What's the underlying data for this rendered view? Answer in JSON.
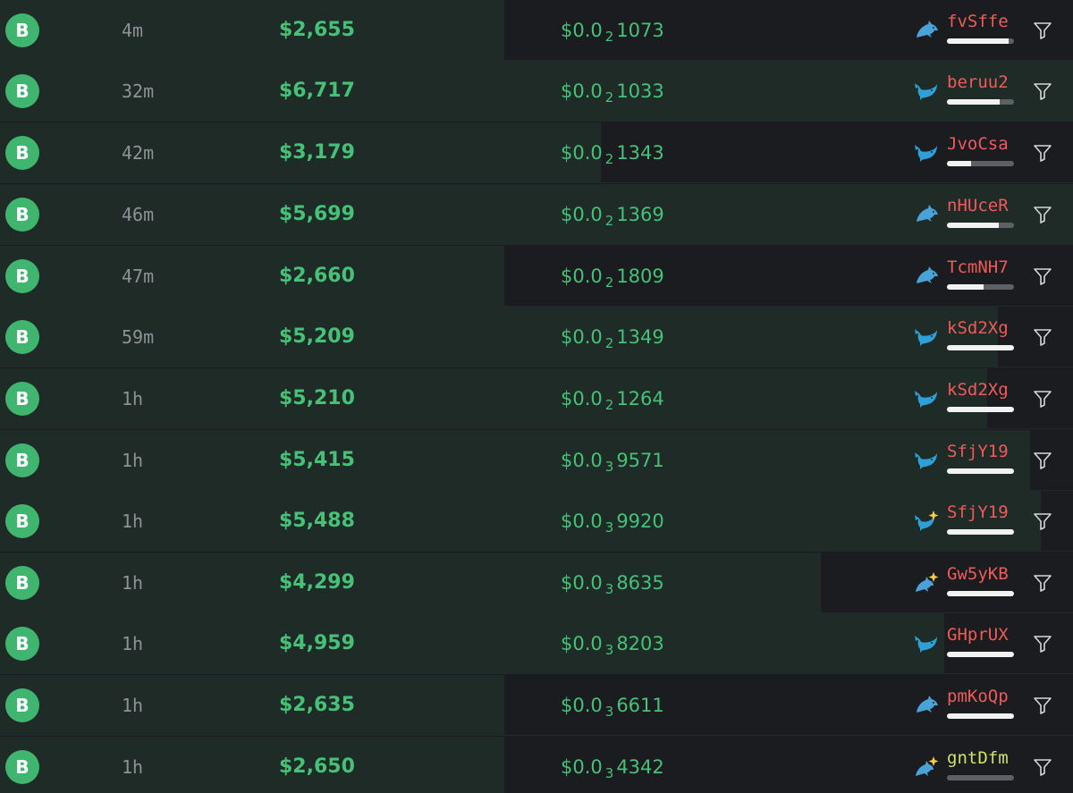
{
  "rows": [
    {
      "side": "B",
      "age": "4m",
      "usd": "$2,655",
      "price_prefix": "$0.0",
      "price_zeros": "2",
      "price_digits": "1073",
      "maker": "fvSffe",
      "maker_icon": "dolphin-icon",
      "maker_color": "red",
      "maker_level": 0.92,
      "bar_fraction": 0.47
    },
    {
      "side": "B",
      "age": "32m",
      "usd": "$6,717",
      "price_prefix": "$0.0",
      "price_zeros": "2",
      "price_digits": "1033",
      "maker": "beruu2",
      "maker_icon": "whale-icon",
      "maker_color": "red",
      "maker_level": 0.78,
      "bar_fraction": 1.0
    },
    {
      "side": "B",
      "age": "42m",
      "usd": "$3,179",
      "price_prefix": "$0.0",
      "price_zeros": "2",
      "price_digits": "1343",
      "maker": "JvoCsa",
      "maker_icon": "whale-icon",
      "maker_color": "red",
      "maker_level": 0.36,
      "bar_fraction": 0.56
    },
    {
      "side": "B",
      "age": "46m",
      "usd": "$5,699",
      "price_prefix": "$0.0",
      "price_zeros": "2",
      "price_digits": "1369",
      "maker": "nHUceR",
      "maker_icon": "dolphin-icon",
      "maker_color": "red",
      "maker_level": 0.77,
      "bar_fraction": 1.0
    },
    {
      "side": "B",
      "age": "47m",
      "usd": "$2,660",
      "price_prefix": "$0.0",
      "price_zeros": "2",
      "price_digits": "1809",
      "maker": "TcmNH7",
      "maker_icon": "dolphin-icon",
      "maker_color": "red",
      "maker_level": 0.54,
      "bar_fraction": 0.47
    },
    {
      "side": "B",
      "age": "59m",
      "usd": "$5,209",
      "price_prefix": "$0.0",
      "price_zeros": "2",
      "price_digits": "1349",
      "maker": "kSd2Xg",
      "maker_icon": "whale-icon",
      "maker_color": "red",
      "maker_level": 1.0,
      "bar_fraction": 0.93
    },
    {
      "side": "B",
      "age": "1h",
      "usd": "$5,210",
      "price_prefix": "$0.0",
      "price_zeros": "2",
      "price_digits": "1264",
      "maker": "kSd2Xg",
      "maker_icon": "whale-icon",
      "maker_color": "red",
      "maker_level": 1.0,
      "bar_fraction": 0.92
    },
    {
      "side": "B",
      "age": "1h",
      "usd": "$5,415",
      "price_prefix": "$0.0",
      "price_zeros": "3",
      "price_digits": "9571",
      "maker": "SfjY19",
      "maker_icon": "whale-icon",
      "maker_color": "red",
      "maker_level": 1.0,
      "bar_fraction": 0.96
    },
    {
      "side": "B",
      "age": "1h",
      "usd": "$5,488",
      "price_prefix": "$0.0",
      "price_zeros": "3",
      "price_digits": "9920",
      "maker": "SfjY19",
      "maker_icon": "sparkle-whale-icon",
      "maker_color": "red",
      "maker_level": 1.0,
      "bar_fraction": 0.97
    },
    {
      "side": "B",
      "age": "1h",
      "usd": "$4,299",
      "price_prefix": "$0.0",
      "price_zeros": "3",
      "price_digits": "8635",
      "maker": "Gw5yKB",
      "maker_icon": "sparkle-dolphin-icon",
      "maker_color": "red",
      "maker_level": 1.0,
      "bar_fraction": 0.765
    },
    {
      "side": "B",
      "age": "1h",
      "usd": "$4,959",
      "price_prefix": "$0.0",
      "price_zeros": "3",
      "price_digits": "8203",
      "maker": "GHprUX",
      "maker_icon": "whale-icon",
      "maker_color": "red",
      "maker_level": 1.0,
      "bar_fraction": 0.88
    },
    {
      "side": "B",
      "age": "1h",
      "usd": "$2,635",
      "price_prefix": "$0.0",
      "price_zeros": "3",
      "price_digits": "6611",
      "maker": "pmKoQp",
      "maker_icon": "dolphin-icon",
      "maker_color": "red",
      "maker_level": 1.0,
      "bar_fraction": 0.47
    },
    {
      "side": "B",
      "age": "1h",
      "usd": "$2,650",
      "price_prefix": "$0.0",
      "price_zeros": "3",
      "price_digits": "4342",
      "maker": "gntDfm",
      "maker_icon": "sparkle-dolphin-icon",
      "maker_color": "lime",
      "maker_level": 0.0,
      "bar_fraction": 0.47
    }
  ],
  "colors": {
    "buy_green": "#45c278",
    "badge_green": "#3fb56f",
    "maker_red": "#ef5a5a",
    "maker_lime": "#cde36a",
    "row_tint": "#1e2b27",
    "background": "#1b1c1f",
    "whale_blue": "#2f9fd8"
  }
}
